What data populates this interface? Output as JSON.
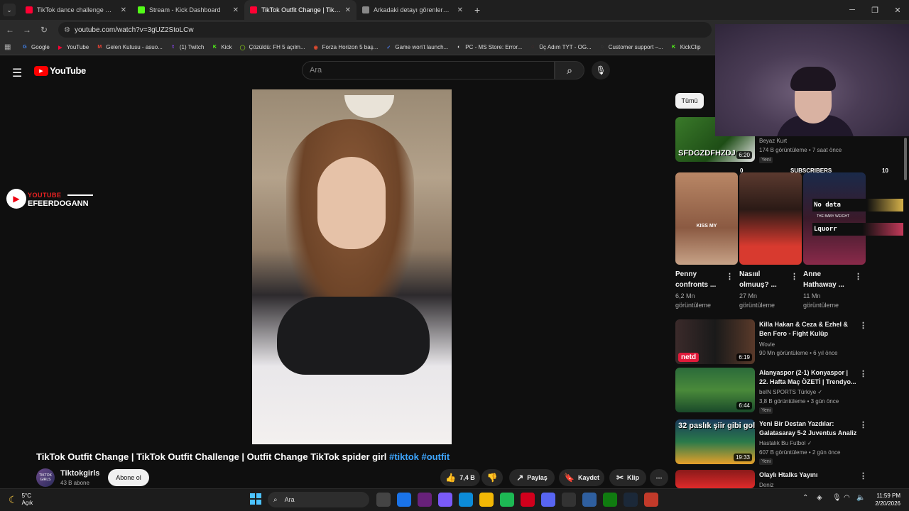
{
  "browser": {
    "tabs": [
      {
        "title": "TikTok dance challenge 💜😈🎀",
        "fav": "#ff0033"
      },
      {
        "title": "Stream - Kick Dashboard",
        "fav": "#53fc18"
      },
      {
        "title": "TikTok Outfit Change | TikTok Ou",
        "fav": "#ff0033"
      },
      {
        "title": "Arkadaki detayı görenler🥺 #sh",
        "fav": "#888888"
      }
    ],
    "url": "youtube.com/watch?v=3gUZ2StoLCw",
    "bookmarks": [
      {
        "label": "Google",
        "icon": "G",
        "color": "#4285f4"
      },
      {
        "label": "YouTube",
        "icon": "▶",
        "color": "#ff0033"
      },
      {
        "label": "Gelen Kutusu - asuo...",
        "icon": "M",
        "color": "#ea4335"
      },
      {
        "label": "(1) Twitch",
        "icon": "t",
        "color": "#9146ff"
      },
      {
        "label": "Kick",
        "icon": "K",
        "color": "#53fc18"
      },
      {
        "label": "Çözüldü: FH 5 açılm...",
        "icon": "◯",
        "color": "#7ab317"
      },
      {
        "label": "Forza Horizon 5 baş...",
        "icon": "◉",
        "color": "#e04a2f"
      },
      {
        "label": "Game won't launch...",
        "icon": "✓",
        "color": "#4b7bec"
      },
      {
        "label": "PC - MS Store: Error...",
        "icon": "◐",
        "color": "#dddddd"
      },
      {
        "label": "Üç Adım TYT - OG...",
        "icon": "◌",
        "color": "#6d2a2a"
      },
      {
        "label": "Customer support –...",
        "icon": "◌",
        "color": "#555555"
      },
      {
        "label": "KickClip",
        "icon": "K",
        "color": "#53fc18"
      }
    ]
  },
  "youtube": {
    "logo_text": "YouTube",
    "search_placeholder": "Ara",
    "chip_all": "Tümü"
  },
  "watermark": {
    "line1": "YOUTUBE",
    "line2": "EFEERDOGANN"
  },
  "video": {
    "title": "TikTok Outfit Change | TikTok Outfit Challenge | Outfit Change TikTok spider girl",
    "tags": "#tiktok #outfit",
    "channel": "Tiktokgirls",
    "avatar_text": "TIKTOK GIRLS",
    "subscribers": "43 B abone",
    "subscribe": "Abone ol",
    "likes": "7,4 B",
    "share": "Paylaş",
    "save": "Kaydet",
    "clip": "Klip",
    "more": "⋯"
  },
  "sidebar": {
    "first": {
      "channel": "Beyaz Kurt",
      "meta": "174 B görüntüleme • 7 saat önce",
      "badge": "Yeni",
      "duration": "6:20",
      "thumb_text": "SFDGZDFHZDJ"
    },
    "shorts": [
      {
        "title": "Penny confronts ...",
        "views": "6,2 Mn",
        "views2": "görüntüleme",
        "caption": "KISS MY"
      },
      {
        "title": "Nasıııl olmuuş? ...",
        "views": "27 Mn",
        "views2": "görüntüleme",
        "caption": ""
      },
      {
        "title": "Anne Hathaway ...",
        "views": "11 Mn",
        "views2": "görüntüleme",
        "caption": ""
      }
    ],
    "videos": [
      {
        "title1": "Killa Hakan & Ceza & Ezhel &",
        "title2": "Ben Fero - Fight Kulüp",
        "channel": "Wovie",
        "meta": "90 Mn görüntüleme • 6 yıl önce",
        "badge": "",
        "duration": "6:19",
        "thumb_text": "netd"
      },
      {
        "title1": "Alanyaspor (2-1) Konyaspor |",
        "title2": "22. Hafta Maç ÖZETİ | Trendyo...",
        "channel": "beIN SPORTS Türkiye ✓",
        "meta": "3,8 B görüntüleme • 3 gün önce",
        "badge": "Yeni",
        "duration": "6:44",
        "thumb_text": ""
      },
      {
        "title1": "Yeni Bir Destan Yazdılar:",
        "title2": "Galatasaray 5-2 Juventus Analiz",
        "channel": "Hastalık Bu Futbol ✓",
        "meta": "607 B görüntüleme • 2 gün önce",
        "badge": "Yeni",
        "duration": "19:33",
        "thumb_text": "32 paslık şiir gibi gol"
      },
      {
        "title1": "Olaylı Htalks Yayını",
        "title2": "",
        "channel": "Deniz",
        "meta": "",
        "badge": "",
        "duration": "",
        "thumb_text": ""
      }
    ]
  },
  "widget": {
    "left": "0",
    "label": "SUBSCRIBERS",
    "right": "10",
    "bar1": "No data",
    "small": "THE BABY WEIGHT",
    "bar2": "Lquorr"
  },
  "taskbar": {
    "temp": "5°C",
    "weather": "Açık",
    "search": "Ara",
    "time": "11:59 PM",
    "date": "2/20/2026"
  }
}
